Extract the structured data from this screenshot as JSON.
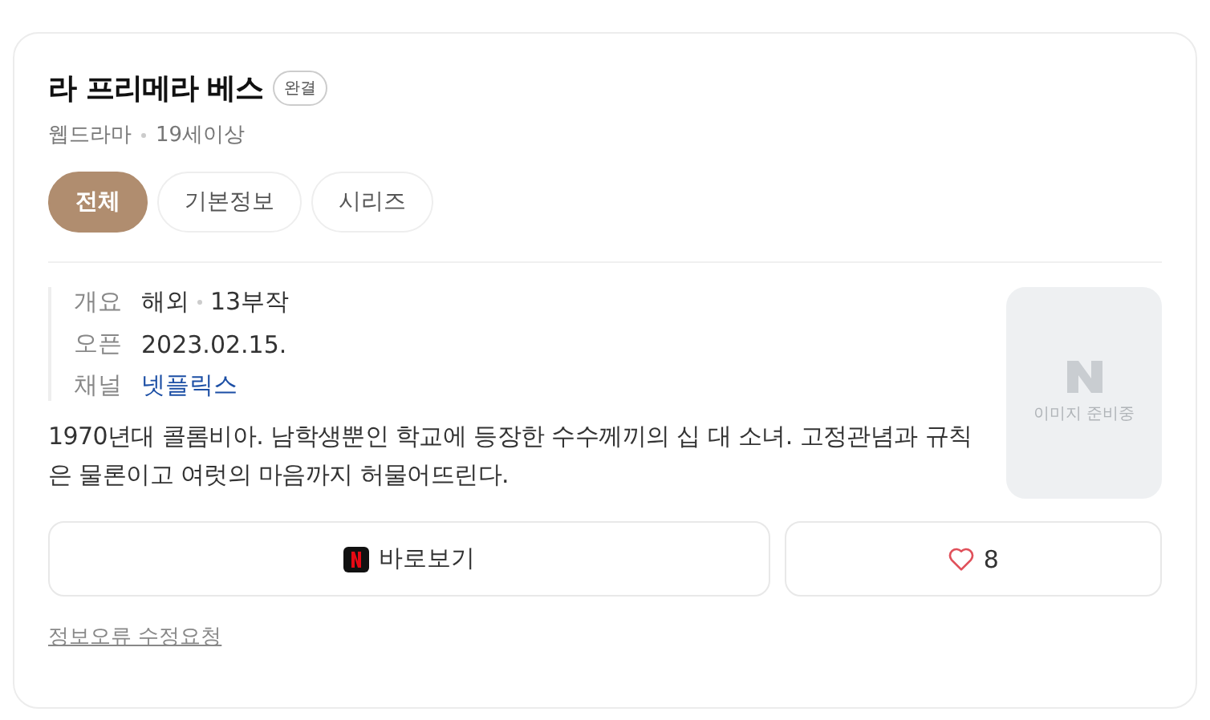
{
  "title": "라 프리메라 베스",
  "status_badge": "완결",
  "meta": [
    "웹드라마",
    "19세이상"
  ],
  "tabs": [
    {
      "label": "전체",
      "selected": true
    },
    {
      "label": "기본정보",
      "selected": false
    },
    {
      "label": "시리즈",
      "selected": false
    }
  ],
  "info": [
    {
      "label": "개요",
      "values": [
        "해외",
        "13부작"
      ],
      "kind": "text"
    },
    {
      "label": "오픈",
      "values": [
        "2023.02.15."
      ],
      "kind": "text"
    },
    {
      "label": "채널",
      "values": [
        "넷플릭스"
      ],
      "kind": "link"
    }
  ],
  "poster_placeholder": "이미지 준비중",
  "description": "1970년대 콜롬비아. 남학생뿐인 학교에 등장한 수수께끼의 십 대 소녀. 고정관념과 규칙은 물론이고 여럿의 마음까지 허물어뜨린다.",
  "watch_button": "바로보기",
  "like_count": "8",
  "report_link": "정보오류 수정요청"
}
